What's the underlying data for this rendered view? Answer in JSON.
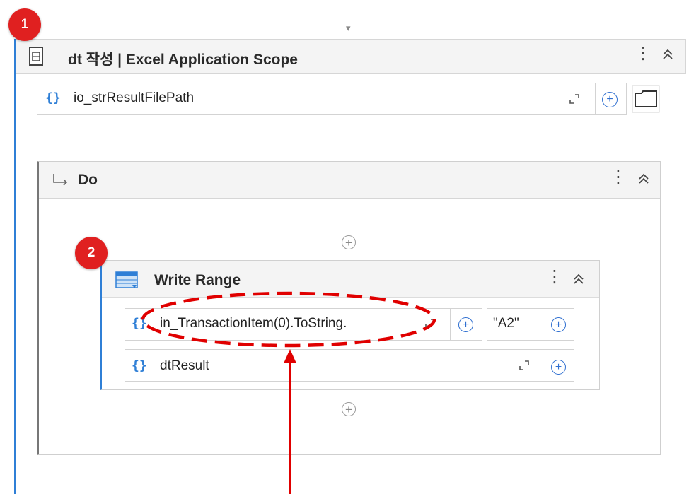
{
  "annotations": {
    "badge1": "1",
    "badge2": "2"
  },
  "excel_scope": {
    "title": "dt 작성 | Excel Application Scope",
    "workbook_path": "io_strResultFilePath",
    "field_prefix": "{}"
  },
  "do_sequence": {
    "title": "Do"
  },
  "write_range": {
    "title": "Write Range",
    "sheet_name": "in_TransactionItem(0).ToString.",
    "starting_cell": "\"A2\"",
    "data_table": "dtResult",
    "field_prefix": "{}"
  },
  "icons": {
    "kebab": "⋮",
    "collapse": "≈",
    "arrow_down": "▾",
    "do_arrow": "↳",
    "plus": "+",
    "expand": "⌐"
  },
  "colors": {
    "accent": "#2f7fd6",
    "badge": "#e02020",
    "annotation": "#e00000"
  }
}
